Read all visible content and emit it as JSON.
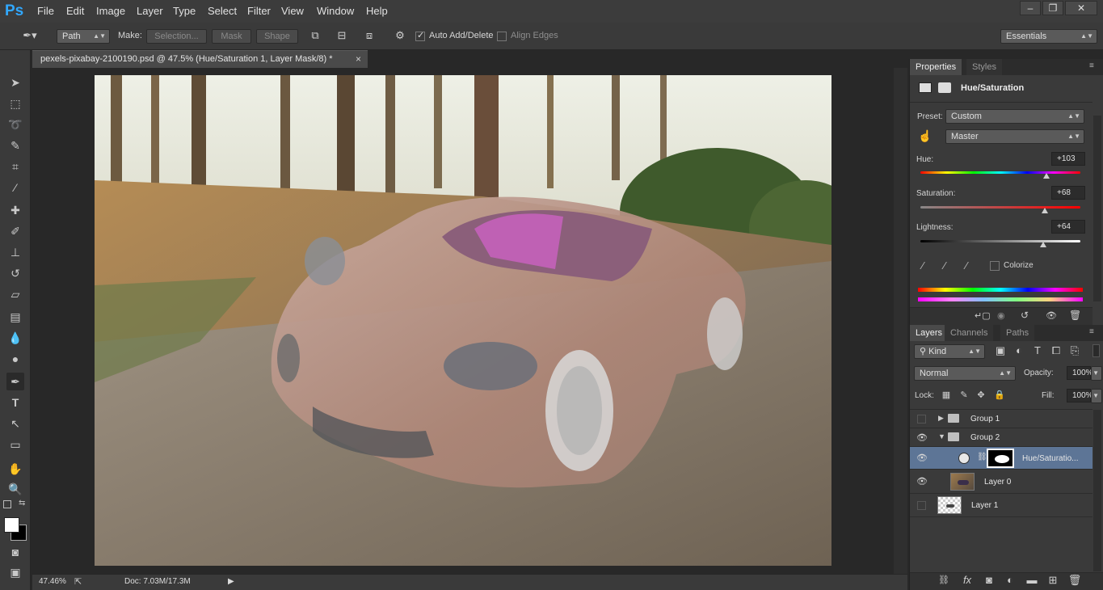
{
  "app": {
    "logo": "Ps"
  },
  "menu": [
    "File",
    "Edit",
    "Image",
    "Layer",
    "Type",
    "Select",
    "Filter",
    "View",
    "Window",
    "Help"
  ],
  "window_controls": {
    "minimize": "minimize-icon",
    "restore": "restore-icon",
    "close": "close-icon"
  },
  "options_bar": {
    "tool_mode": "Path",
    "make_label": "Make:",
    "selection_btn": "Selection...",
    "mask_btn": "Mask",
    "shape_btn": "Shape",
    "auto_add_delete": "Auto Add/Delete",
    "auto_add_delete_checked": true,
    "align_edges": "Align Edges",
    "align_edges_checked": false,
    "workspace": "Essentials"
  },
  "document": {
    "tab_title": "pexels-pixabay-2100190.psd @ 47.5% (Hue/Saturation 1, Layer Mask/8) *",
    "close": "×"
  },
  "status": {
    "zoom": "47.46%",
    "doc_info": "Doc: 7.03M/17.3M"
  },
  "properties": {
    "tabs": [
      "Properties",
      "Styles"
    ],
    "title": "Hue/Saturation",
    "preset_label": "Preset:",
    "preset_value": "Custom",
    "channel_value": "Master",
    "hue_label": "Hue:",
    "hue_value": "+103",
    "saturation_label": "Saturation:",
    "saturation_value": "+68",
    "lightness_label": "Lightness:",
    "lightness_value": "+64",
    "colorize_label": "Colorize",
    "hue_level": 0.79,
    "saturation_level": 0.78,
    "lightness_level": 0.77
  },
  "layers": {
    "tabs": [
      "Layers",
      "Channels",
      "Paths"
    ],
    "filter_kind": "Kind",
    "blend_mode": "Normal",
    "opacity_label": "Opacity:",
    "opacity_value": "100%",
    "lock_label": "Lock:",
    "fill_label": "Fill:",
    "fill_value": "100%",
    "items": [
      {
        "name": "Group 1",
        "visible": false,
        "type": "group",
        "expanded": false
      },
      {
        "name": "Group 2",
        "visible": true,
        "type": "group",
        "expanded": true
      },
      {
        "name": "Hue/Saturatio...",
        "visible": true,
        "type": "adjustment",
        "selected": true
      },
      {
        "name": "Layer 0",
        "visible": true,
        "type": "pixel"
      },
      {
        "name": "Layer 1",
        "visible": false,
        "type": "pixel"
      }
    ]
  },
  "colors": {
    "accent": "#31a8ff",
    "selected_layer": "#5d7596"
  }
}
